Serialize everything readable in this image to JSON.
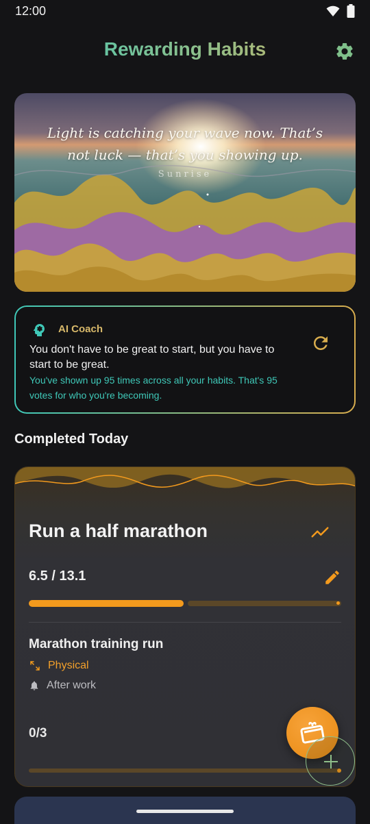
{
  "status_bar": {
    "time": "12:00",
    "icons": [
      "wifi-icon",
      "battery-icon"
    ]
  },
  "header": {
    "title": "Rewarding Habits",
    "settings_icon": "gear-icon",
    "accent": "#3fc8b8"
  },
  "hero": {
    "quote": "Light is catching your wave now. That’s not luck — that’s you showing up.",
    "theme_label": "Sunrise"
  },
  "ai_coach": {
    "icon": "brain-head-icon",
    "title": "AI Coach",
    "message": "You don't have to be great to start, but you have to start to be great.",
    "insight": "You've shown up 95 times across all your habits. That's 95 votes for who you're becoming.",
    "refresh_icon": "refresh-icon"
  },
  "completed_today": {
    "section_title": "Completed Today",
    "goal": {
      "title": "Run a half marathon",
      "progress_text": "6.5 / 13.1",
      "progress_fraction": 0.496,
      "habit": {
        "title": "Marathon training run",
        "category": "Physical",
        "reminder": "After work",
        "count_text": "0/3",
        "count_fraction": 0
      }
    }
  },
  "fabs": {
    "reward": "gift-card-icon",
    "add": "plus-icon"
  },
  "colors": {
    "orange": "#f39a1d",
    "teal": "#3fc8b8",
    "gold": "#d8ad4e",
    "background": "#141416"
  }
}
